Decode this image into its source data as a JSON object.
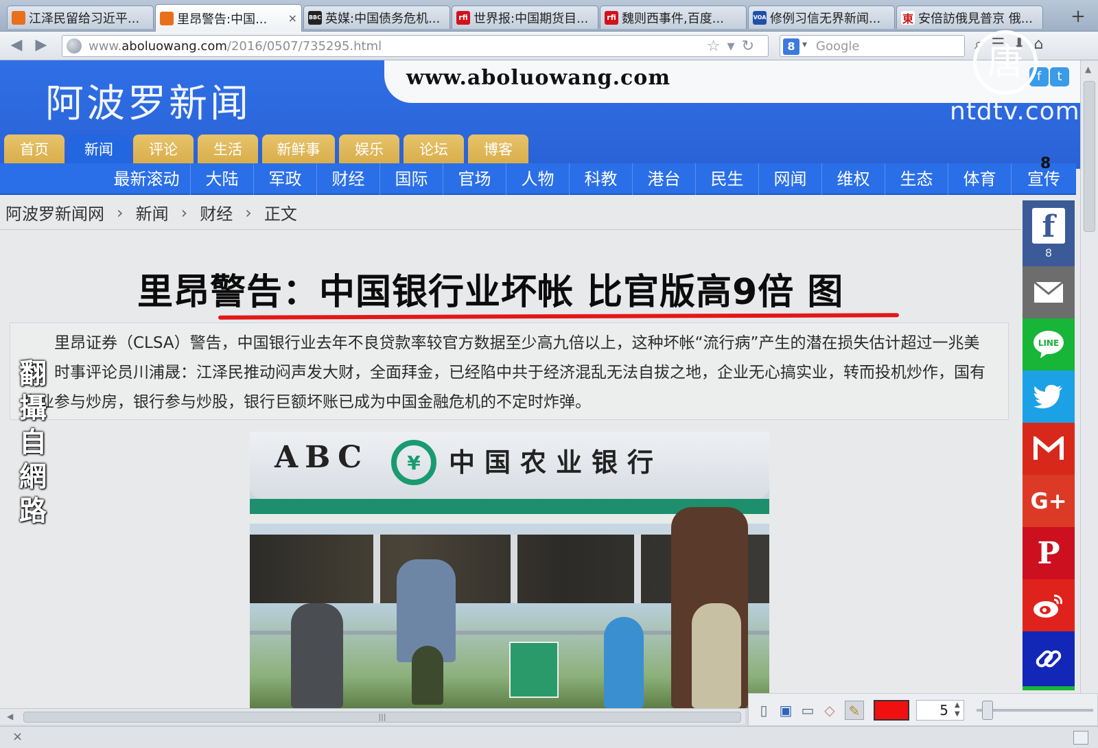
{
  "browser": {
    "tabs": [
      {
        "label": "江泽民留给习近平...",
        "icon": "doc-icon",
        "icon_color": "#e8701a",
        "icon_text": ""
      },
      {
        "label": "里昂警告:中国...",
        "icon": "doc-icon",
        "icon_color": "#e8701a",
        "icon_text": "",
        "active": true,
        "close": "×"
      },
      {
        "label": "英媒:中国债务危机...",
        "icon": "news-icon",
        "icon_color": "#222222",
        "icon_text": "BBC"
      },
      {
        "label": "世界报:中国期货目...",
        "icon": "rfi-icon",
        "icon_color": "#d3111b",
        "icon_text": "rfi"
      },
      {
        "label": "魏则西事件,百度...",
        "icon": "rfi-icon",
        "icon_color": "#d3111b",
        "icon_text": "rfi"
      },
      {
        "label": "修例习信无界新闻...",
        "icon": "voa-icon",
        "icon_color": "#1f4fa8",
        "icon_text": "VOA"
      },
      {
        "label": "安倍訪俄見普京 俄...",
        "icon": "east-icon",
        "icon_color": "#cc1a1a",
        "icon_text": "東"
      }
    ],
    "new_tab": "+",
    "url_prefix": "www.",
    "url_domain": "aboluowang.com",
    "url_path": "/2016/0507/735295.html",
    "search_placeholder": "Google",
    "search_engine_badge": "8"
  },
  "site": {
    "name": "阿波罗新闻",
    "domain": "www.aboluowang.com",
    "main_tabs": [
      "首页",
      "新闻",
      "评论",
      "生活",
      "新鲜事",
      "娱乐",
      "论坛",
      "博客"
    ],
    "active_main_tab": "新闻",
    "sub_nav": [
      "最新滚动",
      "大陆",
      "军政",
      "财经",
      "国际",
      "官场",
      "人物",
      "科教",
      "港台",
      "民生",
      "网闻",
      "维权",
      "生态",
      "体育",
      "宣传"
    ],
    "sub_nav_badge": "8"
  },
  "breadcrumb": [
    "阿波罗新闻网",
    "新闻",
    "财经",
    "正文"
  ],
  "article": {
    "headline": "里昂警告：中国银行业坏帐 比官版高9倍 图",
    "summary": "里昂证券（CLSA）警告，中国银行业去年不良贷款率较官方数据至少高九倍以上，这种坏帐“流行病”产生的潜在损失估计超过一兆美元，时事评论员川浦晟：江泽民推动闷声发大财，全面拜金，已经陷中共于经济混乱无法自拔之地，企业无心搞实业，转而投机炒作，国有企业参与炒房，银行参与炒股，银行巨额坏账已成为中国金融危机的不定时炸弹。",
    "photo_text_latin": "ABC",
    "photo_text_cn": "中国农业银行",
    "photo_emblem": "¥"
  },
  "share": {
    "facebook_count": "8",
    "colors": {
      "facebook": "#3b5a98",
      "email": "#6d6d6d",
      "line": "#17b538",
      "twitter": "#1da1e6",
      "gmail": "#d8281c",
      "google_plus": "#dc3a26",
      "pinterest": "#cc1020",
      "weibo": "#e0221c",
      "link": "#1226b8"
    }
  },
  "broadcaster": {
    "logo_char": "唐",
    "domain": "ntdtv.com",
    "overlay": [
      "翻",
      "攝",
      "自",
      "網",
      "路"
    ]
  },
  "draw_tools": {
    "size": "5",
    "color": "#f01010"
  },
  "status": {
    "close_glyph": "×"
  },
  "scrollbar_grip": "|||"
}
